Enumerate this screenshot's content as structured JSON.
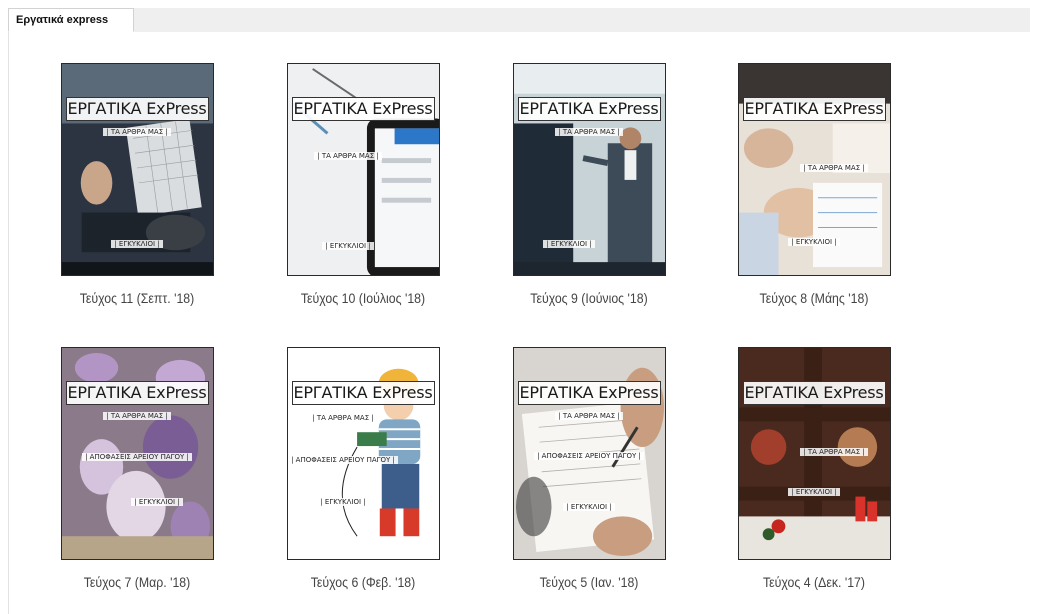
{
  "tab": {
    "label": "Εργατικά express"
  },
  "magazine": {
    "masthead": "ΕΡΓΑΤΙΚΑ ExPress"
  },
  "sections": {
    "arora": "| ΤΑ ΑΡΘΡΑ ΜΑΣ |",
    "egkyklioi": "| ΕΓΚΥΚΛΙΟΙ |",
    "apofaseis": "| ΑΠΟΦΑΣΕΙΣ ΑΡΕΙΟΥ ΠΑΓΟΥ |"
  },
  "issues": [
    {
      "caption": "Τεύχος 11 (Σεπτ. '18)"
    },
    {
      "caption": "Τεύχος 10 (Ιούλιος '18)"
    },
    {
      "caption": "Τεύχος 9 (Ιούνιος '18)"
    },
    {
      "caption": "Τεύχος 8 (Μάης '18)"
    },
    {
      "caption": "Τεύχος 7 (Μαρ. '18)"
    },
    {
      "caption": "Τεύχος 6 (Φεβ. '18)"
    },
    {
      "caption": "Τεύχος 5 (Ιαν. '18)"
    },
    {
      "caption": "Τεύχος 4 (Δεκ. '17)"
    }
  ]
}
